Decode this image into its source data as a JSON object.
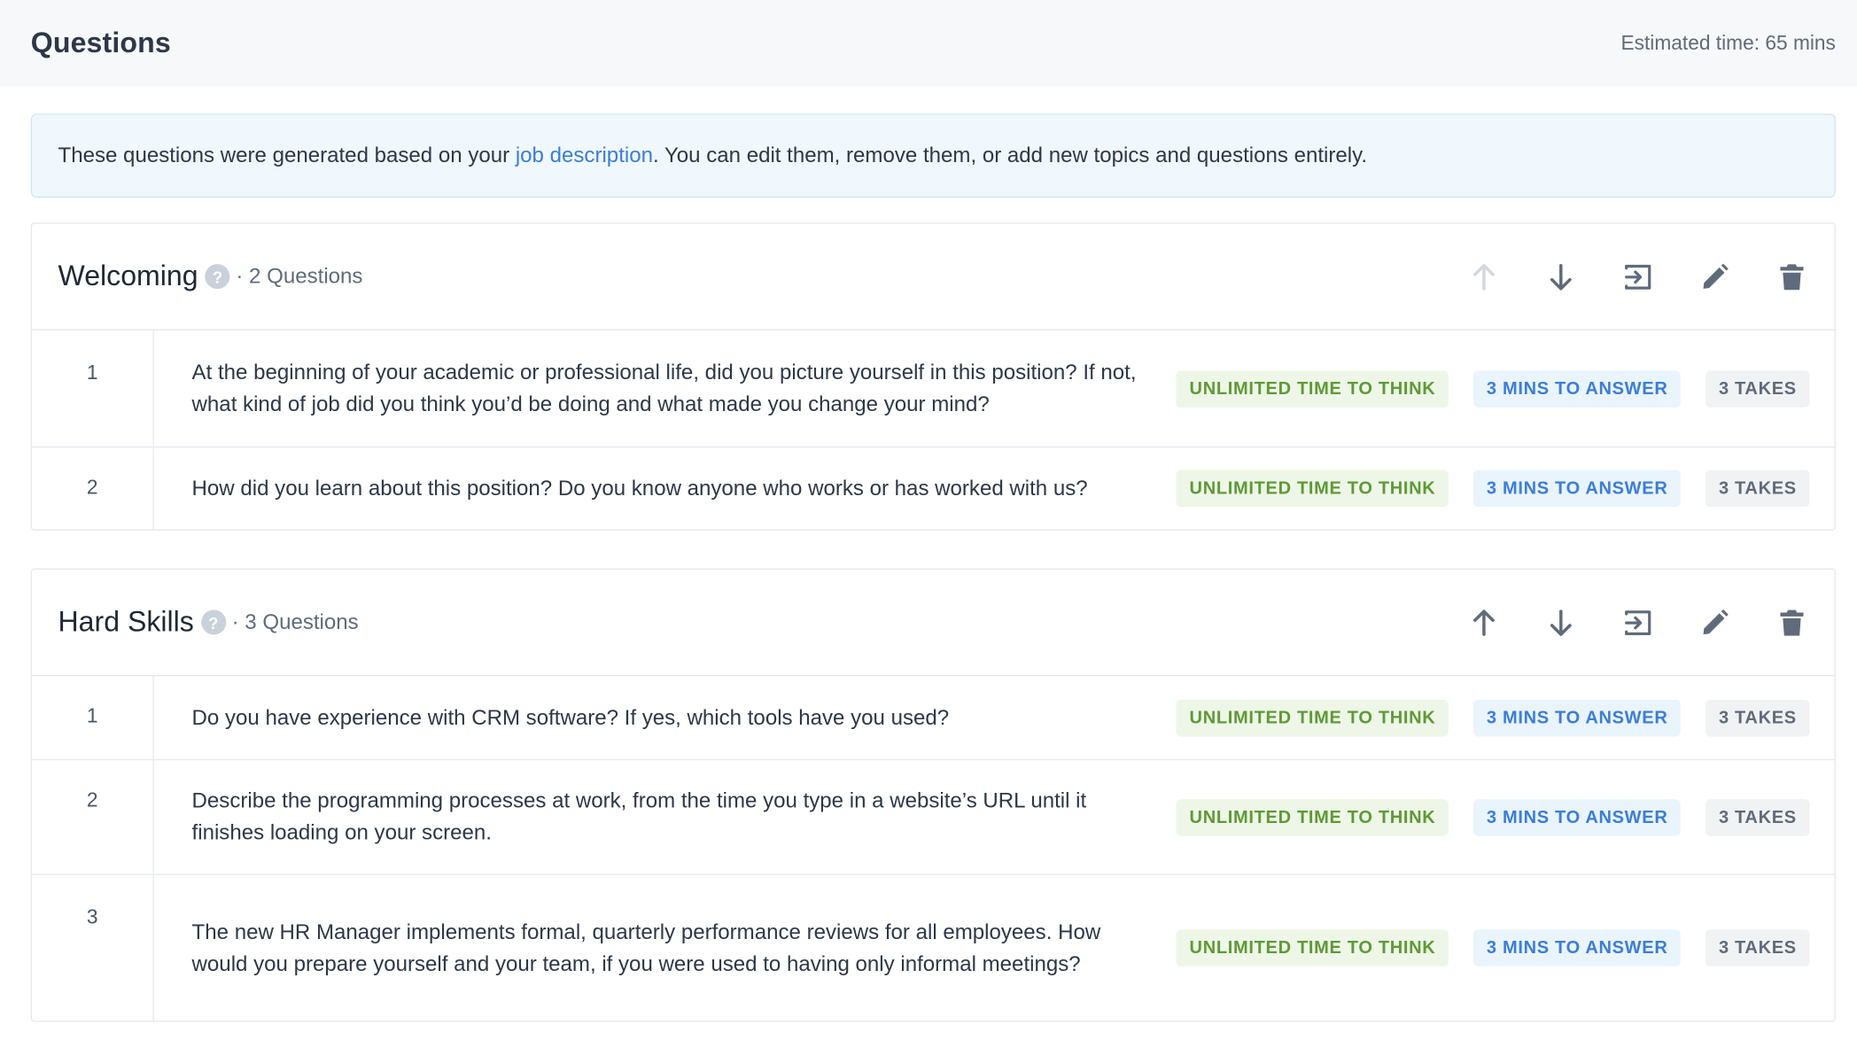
{
  "header": {
    "title": "Questions",
    "estimated_time": "Estimated time: 65 mins"
  },
  "banner": {
    "text_before": "These questions were generated based on your ",
    "link_text": "job description",
    "text_after": ". You can edit them, remove them, or add new topics and questions entirely."
  },
  "topics": [
    {
      "name": "Welcoming",
      "count": "· 2 Questions",
      "questions": [
        {
          "number": "1",
          "text": "At the beginning of your academic or professional life, did you picture yourself in this position? If not, what kind of job did you think you’d be doing and what made you change your mind?",
          "think": "UNLIMITED TIME TO THINK",
          "answer": "3 MINS TO ANSWER",
          "takes": "3 TAKES"
        },
        {
          "number": "2",
          "text": "How did you learn about this position? Do you know anyone who works or has worked with us?",
          "think": "UNLIMITED TIME TO THINK",
          "answer": "3 MINS TO ANSWER",
          "takes": "3 TAKES"
        }
      ]
    },
    {
      "name": "Hard Skills",
      "count": "· 3 Questions",
      "questions": [
        {
          "number": "1",
          "text": "Do you have experience with CRM software? If yes, which tools have you used?",
          "think": "UNLIMITED TIME TO THINK",
          "answer": "3 MINS TO ANSWER",
          "takes": "3 TAKES"
        },
        {
          "number": "2",
          "text": "Describe the programming processes at work, from the time you type in a website’s URL until it finishes loading on your screen.",
          "think": "UNLIMITED TIME TO THINK",
          "answer": "3 MINS TO ANSWER",
          "takes": "3 TAKES"
        },
        {
          "number": "3",
          "text": "The new HR Manager implements formal, quarterly performance reviews for all employees. How would you prepare yourself and your team, if you were used to having only informal meetings?",
          "think": "UNLIMITED TIME TO THINK",
          "answer": "3 MINS TO ANSWER",
          "takes": "3 TAKES"
        }
      ]
    }
  ],
  "icons": {
    "help": "?",
    "move_up": "arrow-up-icon",
    "move_down": "arrow-down-icon",
    "move_to": "move-to-icon",
    "edit": "pencil-icon",
    "delete": "trash-icon"
  },
  "colors": {
    "accent": "#3b7dd8",
    "think_tag": "#5e9a35",
    "banner_bg": "#f0f8fd"
  }
}
